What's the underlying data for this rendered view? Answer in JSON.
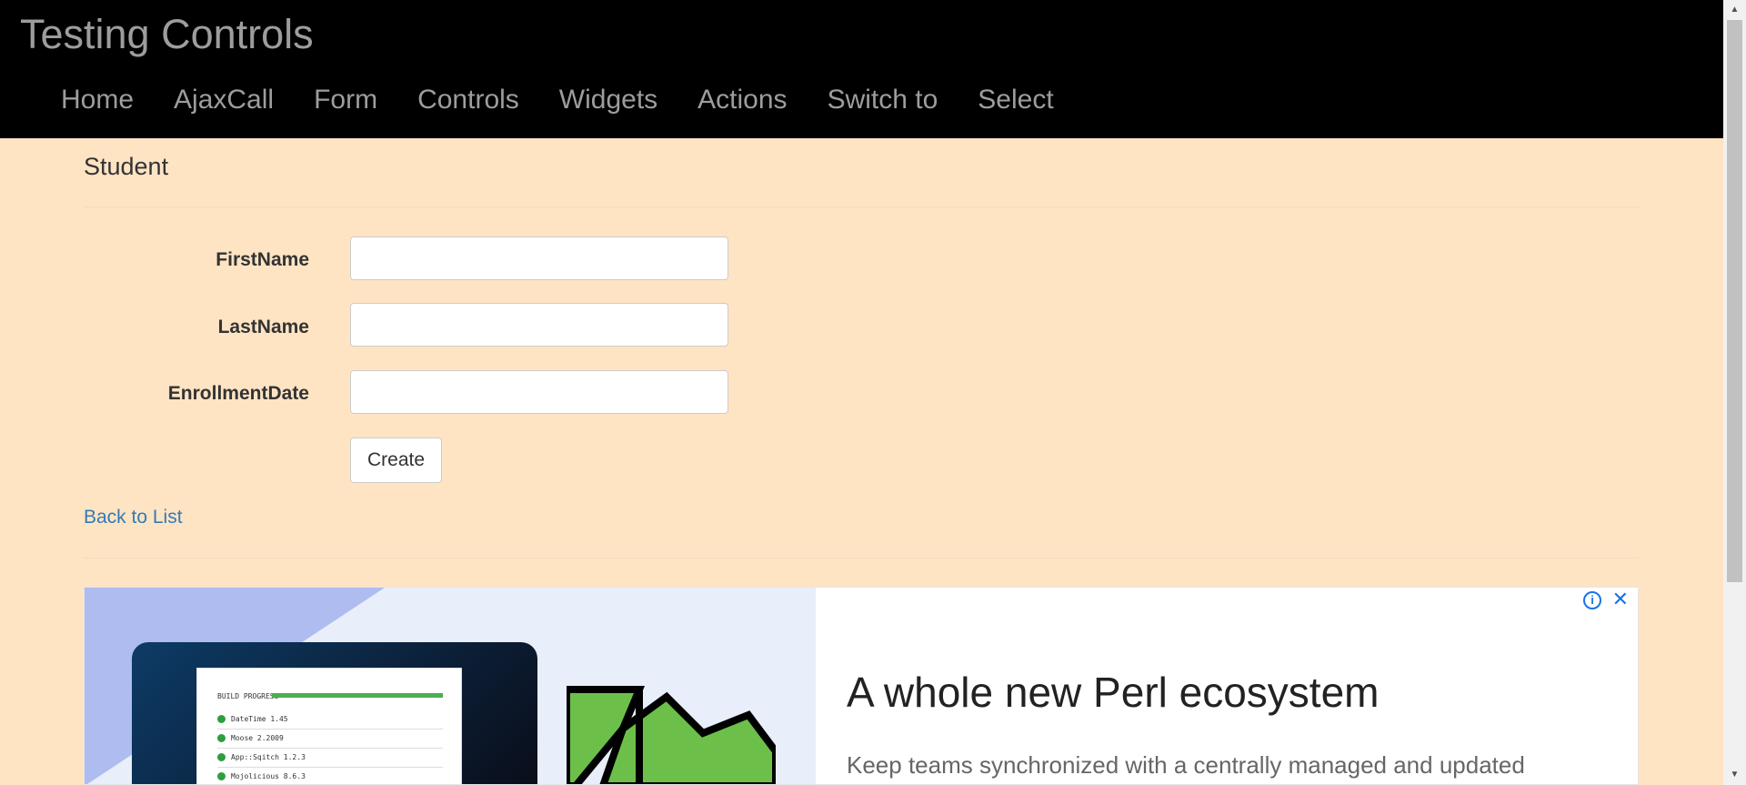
{
  "brand": "Testing Controls",
  "nav": [
    "Home",
    "AjaxCall",
    "Form",
    "Controls",
    "Widgets",
    "Actions",
    "Switch to",
    "Select"
  ],
  "page": {
    "heading": "Student"
  },
  "form": {
    "first_name_label": "FirstName",
    "last_name_label": "LastName",
    "enrollment_date_label": "EnrollmentDate",
    "first_name_value": "",
    "last_name_value": "",
    "enrollment_date_value": "",
    "create_label": "Create"
  },
  "back_link": "Back to List",
  "ad": {
    "headline": "A whole new Perl ecosystem",
    "body": "Keep teams synchronized with a centrally managed and updated",
    "build_title": "BUILD PROGRESS",
    "build_rows": [
      "DateTime  1.45",
      "Moose  2.2009",
      "App::Sqitch  1.2.3",
      "Mojolicious  8.6.3"
    ],
    "info_icon": "info-icon",
    "close_icon": "close-icon"
  },
  "colors": {
    "page_bg": "#ffe4c4",
    "navbar_bg": "#000000",
    "nav_text": "#9d9d9d",
    "link": "#337ab7",
    "build_green": "#4caf50"
  }
}
